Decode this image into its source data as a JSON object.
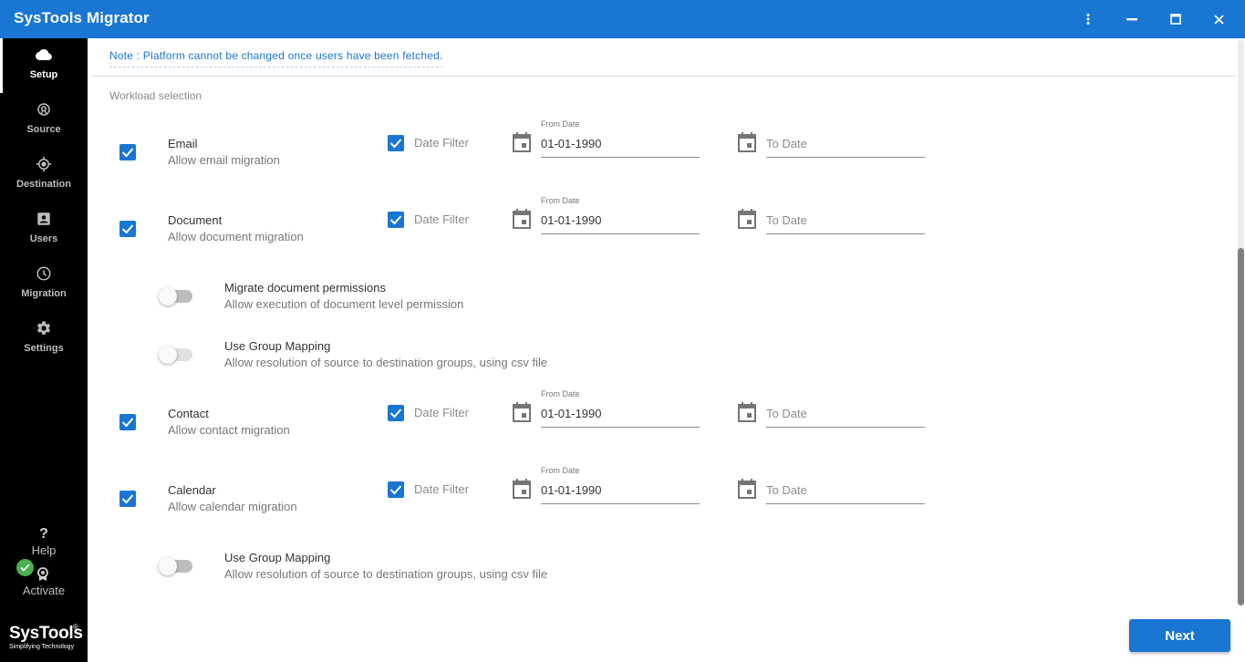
{
  "window": {
    "title": "SysTools Migrator",
    "controls": [
      "more-options",
      "minimize",
      "maximize",
      "close"
    ]
  },
  "sidebar": {
    "items": [
      {
        "label": "Setup",
        "icon": "cloud-icon",
        "active": true
      },
      {
        "label": "Source",
        "icon": "source-icon",
        "active": false
      },
      {
        "label": "Destination",
        "icon": "target-icon",
        "active": false
      },
      {
        "label": "Users",
        "icon": "user-card-icon",
        "active": false
      },
      {
        "label": "Migration",
        "icon": "clock-icon",
        "active": false
      },
      {
        "label": "Settings",
        "icon": "gear-icon",
        "active": false
      }
    ],
    "help": {
      "label": "Help",
      "glyph": "?"
    },
    "activate": {
      "label": "Activate",
      "status": "activated"
    },
    "brand": {
      "name": "SysTools",
      "reg": "®",
      "tagline": "Simplifying Technology"
    }
  },
  "main": {
    "note": "Note : Platform cannot be changed once users have been fetched.",
    "section_title": "Workload selection",
    "workloads": [
      {
        "title": "Email",
        "subtitle": "Allow email migration",
        "checked": true,
        "date_filter_label": "Date Filter",
        "date_filter_checked": true,
        "from_label": "From Date",
        "from_value": "01-01-1990",
        "to_placeholder": "To Date"
      },
      {
        "title": "Document",
        "subtitle": "Allow document migration",
        "checked": true,
        "date_filter_label": "Date Filter",
        "date_filter_checked": true,
        "from_label": "From Date",
        "from_value": "01-01-1990",
        "to_placeholder": "To Date"
      },
      {
        "title": "Contact",
        "subtitle": "Allow contact migration",
        "checked": true,
        "date_filter_label": "Date Filter",
        "date_filter_checked": true,
        "from_label": "From Date",
        "from_value": "01-01-1990",
        "to_placeholder": "To Date"
      },
      {
        "title": "Calendar",
        "subtitle": "Allow calendar migration",
        "checked": true,
        "date_filter_label": "Date Filter",
        "date_filter_checked": true,
        "from_label": "From Date",
        "from_value": "01-01-1990",
        "to_placeholder": "To Date"
      }
    ],
    "options": [
      {
        "title": "Migrate document permissions",
        "subtitle": "Allow execution of document level permission",
        "on": false
      },
      {
        "title": "Use Group Mapping",
        "subtitle": "Allow resolution of source to destination groups, using csv file",
        "on": false
      },
      {
        "title": "Use Group Mapping",
        "subtitle": "Allow resolution of source to destination groups, using csv file",
        "on": false
      }
    ],
    "next_label": "Next"
  },
  "colors": {
    "primary": "#1976d2",
    "sidebar_bg": "#000000",
    "success": "#4caf50"
  }
}
